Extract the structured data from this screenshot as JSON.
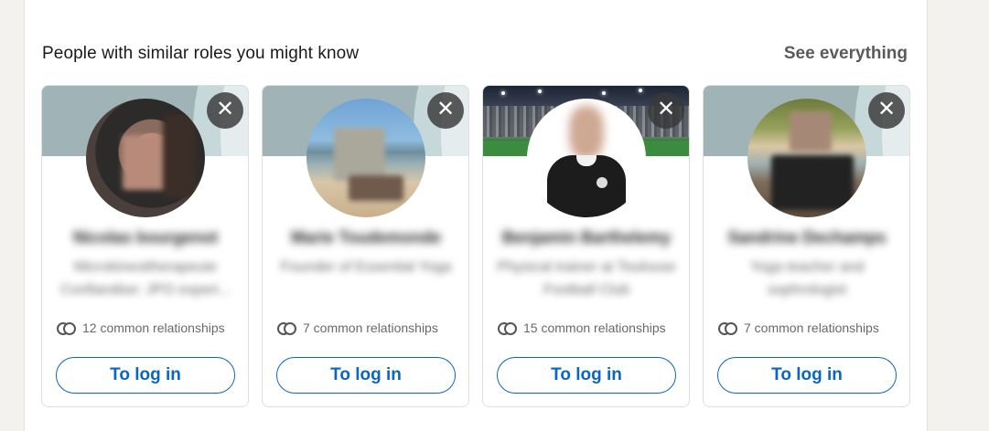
{
  "section": {
    "title": "People with similar roles you might know",
    "see_all_label": "See everything"
  },
  "cards": [
    {
      "name": "Nicolas bourgenot",
      "headline": "Microkinesitherapeute Confiandise: JPO experi...",
      "common": "12 common relationships",
      "action_label": "To log in",
      "close_icon": "close-icon",
      "banner": "default"
    },
    {
      "name": "Marie Toudemonde",
      "headline": "Founder of Essential Yoga",
      "common": "7 common relationships",
      "action_label": "To log in",
      "close_icon": "close-icon",
      "banner": "default"
    },
    {
      "name": "Benjamin Barthelemy",
      "headline": "Physical trainer at Toulouse Football Club",
      "common": "15 common relationships",
      "action_label": "To log in",
      "close_icon": "close-icon",
      "banner": "stadium"
    },
    {
      "name": "Sandrine Dechamps",
      "headline": "Yoga teacher and sophrologist",
      "common": "7 common relationships",
      "action_label": "To log in",
      "close_icon": "close-icon",
      "banner": "default"
    }
  ],
  "colors": {
    "accent": "#0a66c2",
    "banner_default": "#a0b4b7",
    "page_background": "#f3f2ef"
  }
}
